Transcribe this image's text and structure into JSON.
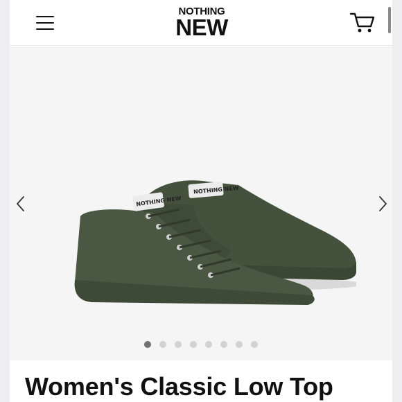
{
  "header": {
    "logo_line1": "NOTHING",
    "logo_line2": "NEW",
    "menu_icon": "hamburger-menu-icon",
    "cart_icon": "shopping-cart-icon"
  },
  "gallery": {
    "prev_icon": "chevron-left-icon",
    "next_icon": "chevron-right-icon",
    "shoe_tag": "NOTHING NEW",
    "slide_count": 8,
    "active_slide": 1,
    "shoe_color": "#4a5743"
  },
  "product": {
    "title": "Women's Classic Low Top"
  }
}
